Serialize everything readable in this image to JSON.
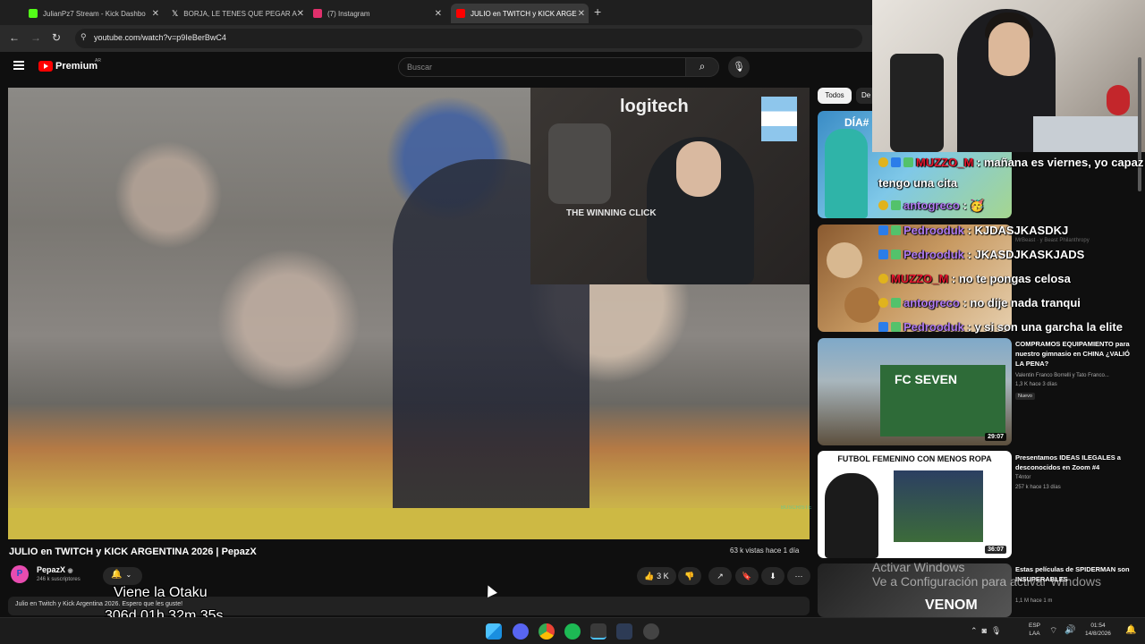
{
  "browser": {
    "tabs": [
      {
        "label": "JulianPz7 Stream - Kick Dashbo",
        "color": "#53fc18"
      },
      {
        "label": "BORJA, LE TENES QUE PEGAR A",
        "color": "#ffffff"
      },
      {
        "label": "(7) Instagram",
        "color": "#e1306c"
      },
      {
        "label": "JULIO en TWITCH y KICK ARGE",
        "color": "#ff0000"
      }
    ],
    "url": "youtube.com/watch?v=p9IeBerBwC4"
  },
  "masthead": {
    "brand": "Premium",
    "country": "AR",
    "search_placeholder": "Buscar"
  },
  "webcam_overlay": {
    "logo": "logitech",
    "poster": "THE WINNING CLICK"
  },
  "player_watermark": "BUSCRISTE",
  "video": {
    "title": "JULIO en TWITCH y KICK ARGENTINA 2026 | PepazX",
    "stats": "63 k vistas  hace 1 día",
    "channel": "PepazX",
    "subs": "246 k suscriptores",
    "likes": "3 K",
    "description": "Julio en Twitch y Kick Argentina 2026. Espero que les guste!"
  },
  "overlay": {
    "name": "Viene la Otaku",
    "timer": "306d 01h 32m 35s"
  },
  "sidebar": {
    "chips": [
      "Todos",
      "De"
    ],
    "recommendations": [
      {
        "thumb_text": "DÍA#",
        "title": "",
        "meta": [],
        "duration": ""
      },
      {
        "thumb_text": "",
        "title": "",
        "meta": [
          "MrBeast · y Beast Philanthropy"
        ],
        "duration": ""
      },
      {
        "thumb_text": "FC SEVEN",
        "title": "COMPRAMOS EQUIPAMIENTO para nuestro gimnasio en CHINA ¿VALIÓ LA PENA?",
        "meta": [
          "Valentin Franco Borrelli y Tato Franco...",
          "1,3 K  hace 3 días"
        ],
        "badge": "Nuevo",
        "duration": "29:07"
      },
      {
        "thumb_text": "FUTBOL FEMENINO CON MENOS ROPA",
        "title": "Presentamos IDEAS ILEGALES a desconocidos en Zoom #4",
        "meta": [
          "T4ntor",
          "257 k  hace 13 días"
        ],
        "duration": "36:07"
      },
      {
        "thumb_text": "VENOM",
        "title": "Estas películas de SPIDERMAN son INSUPERABLES",
        "meta": [
          "1,1 M  hace 1 m"
        ],
        "duration": ""
      }
    ]
  },
  "chat": [
    {
      "badges": [
        "gold",
        "blue",
        "green"
      ],
      "user": "MUZZO_M",
      "user_color": "red",
      "text": "mañana es viernes, yo capaz"
    },
    {
      "badges": [],
      "user": "",
      "user_color": "white",
      "text": "tengo una cita"
    },
    {
      "badges": [
        "gold",
        "green"
      ],
      "user": "antogreco",
      "user_color": "purple",
      "text": "🥳"
    },
    {
      "badges": [
        "blue",
        "green"
      ],
      "user": "Pedrooduk",
      "user_color": "purple",
      "text": "KJDASJKASDKJ"
    },
    {
      "badges": [
        "blue",
        "green"
      ],
      "user": "Pedrooduk",
      "user_color": "purple",
      "text": "JKASDJKASKJADS"
    },
    {
      "badges": [
        "gold"
      ],
      "user": "MUZZO_M",
      "user_color": "red",
      "text": "no te pongas celosa"
    },
    {
      "badges": [
        "gold",
        "green"
      ],
      "user": "antogreco",
      "user_color": "purple",
      "text": "no dije nada tranqui"
    },
    {
      "badges": [
        "blue",
        "green"
      ],
      "user": "Pedrooduk",
      "user_color": "purple",
      "text": "y si son una garcha la elite"
    }
  ],
  "windows_notice": {
    "line1": "Activar Windows",
    "line2": "Ve a Configuración para activar Windows"
  },
  "taskbar": {
    "lang1": "ESP",
    "lang2": "LAA",
    "time": "01:54",
    "date": "14/8/2026"
  },
  "colors": {
    "accent": "#ff0000",
    "background": "#0f0f0f",
    "chat_red": "#e5162e",
    "chat_purple": "#b07bf0"
  }
}
